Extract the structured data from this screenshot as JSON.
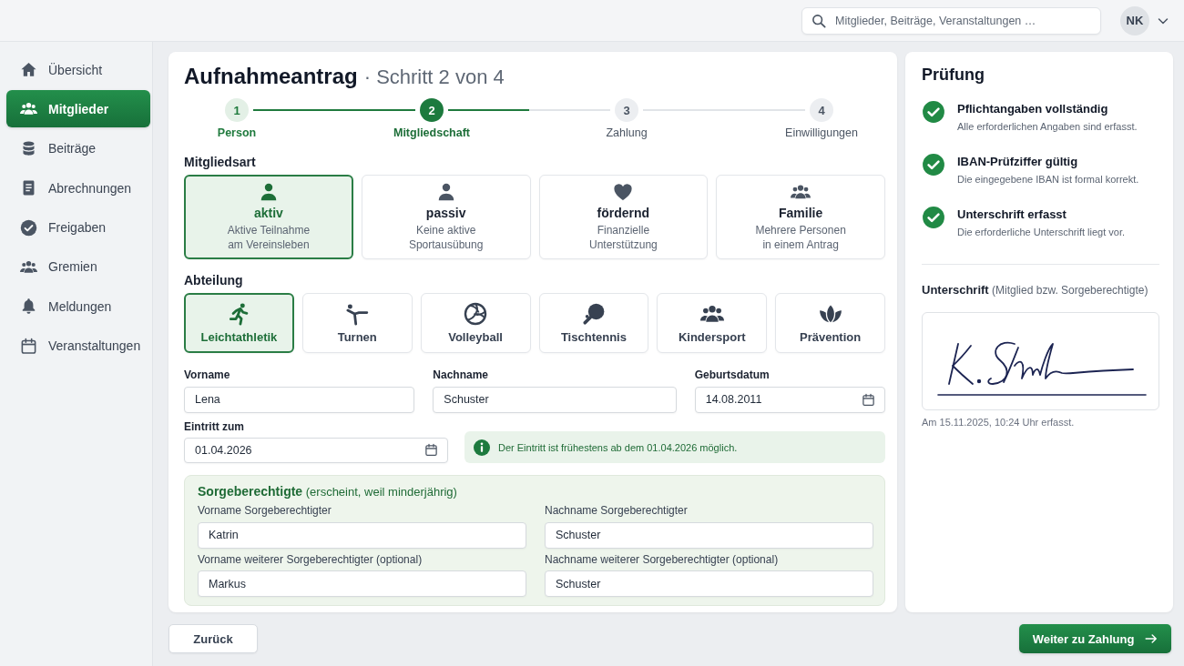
{
  "topbar": {
    "search": {
      "placeholder": "Mitglieder, Beiträge, Veranstaltungen …"
    },
    "user": {
      "initials": "NK"
    }
  },
  "sidebar": {
    "items": [
      {
        "label": "Übersicht",
        "selected": false
      },
      {
        "label": "Mitglieder",
        "selected": true
      },
      {
        "label": "Beiträge",
        "selected": false
      },
      {
        "label": "Abrechnungen",
        "selected": false
      },
      {
        "label": "Freigaben",
        "selected": false
      },
      {
        "label": "Gremien",
        "selected": false
      },
      {
        "label": "Meldungen",
        "selected": false
      },
      {
        "label": "Veranstaltungen",
        "selected": false
      }
    ]
  },
  "form": {
    "title": "Aufnahmeantrag",
    "step_info": "· Schritt 2 von 4",
    "steps": [
      {
        "number": "1",
        "label": "Person",
        "done": true,
        "selected": false
      },
      {
        "number": "2",
        "label": "Mitgliedschaft",
        "done": false,
        "selected": true
      },
      {
        "number": "3",
        "label": "Zahlung",
        "done": false,
        "selected": false
      },
      {
        "number": "4",
        "label": "Einwilligungen",
        "done": false,
        "selected": false
      }
    ],
    "membership": {
      "label": "Mitgliedsart",
      "options": [
        {
          "title": "aktiv",
          "description": "Aktive Teilnahme\nam Vereinsleben",
          "selected": true
        },
        {
          "title": "passiv",
          "description": "Keine aktive\nSportausübung",
          "selected": false
        },
        {
          "title": "fördernd",
          "description": "Finanzielle\nUnterstützung",
          "selected": false
        },
        {
          "title": "Familie",
          "description": "Mehrere Personen\nin einem Antrag",
          "selected": false
        }
      ]
    },
    "department": {
      "label": "Abteilung",
      "options": [
        {
          "label": "Leichtathletik",
          "selected": true
        },
        {
          "label": "Turnen",
          "selected": false
        },
        {
          "label": "Volleyball",
          "selected": false
        },
        {
          "label": "Tischtennis",
          "selected": false
        },
        {
          "label": "Kindersport",
          "selected": false
        },
        {
          "label": "Prävention",
          "selected": false
        }
      ]
    },
    "fields": [
      {
        "label": "Vorname",
        "value": "Lena",
        "kind": "text"
      },
      {
        "label": "Nachname",
        "value": "Schuster",
        "kind": "text"
      },
      {
        "label": "Geburtsdatum",
        "value": "14.08.2011",
        "kind": "date"
      }
    ],
    "entry": {
      "label": "Eintritt zum",
      "value": "01.04.2026",
      "kind": "date"
    },
    "notice": "Der Eintritt ist frühestens ab dem 01.04.2026 möglich.",
    "guardians": {
      "heading": "**Sorgeberechtigte** (erscheint, weil minderjährig)",
      "fields": [
        {
          "label": "Vorname Sorgeberechtigter",
          "value": "Katrin"
        },
        {
          "label": "Nachname Sorgeberechtigter",
          "value": "Schuster"
        },
        {
          "label": "Vorname weiterer Sorgeberechtigter (optional)",
          "value": "Markus"
        },
        {
          "label": "Nachname weiterer Sorgeberechtigter (optional)",
          "value": "Schuster"
        }
      ]
    }
  },
  "review": {
    "title": "Prüfung",
    "checks": [
      {
        "title": "Pflichtangaben vollständig",
        "description": "Alle erforderlichen Angaben sind erfasst.",
        "passed": true
      },
      {
        "title": "IBAN-Prüfziffer gültig",
        "description": "Die eingegebene IBAN ist formal korrekt.",
        "passed": true
      },
      {
        "title": "Unterschrift erfasst",
        "description": "Die erforderliche Unterschrift liegt vor.",
        "passed": true
      }
    ],
    "signature": {
      "label": "**Unterschrift** (Mitglied bzw. Sorgeberechtigte)",
      "captured": "Am 15.11.2025, 10:24 Uhr erfasst."
    }
  },
  "actions": {
    "back": "Zurück",
    "next": "Weiter zu Zahlung"
  }
}
